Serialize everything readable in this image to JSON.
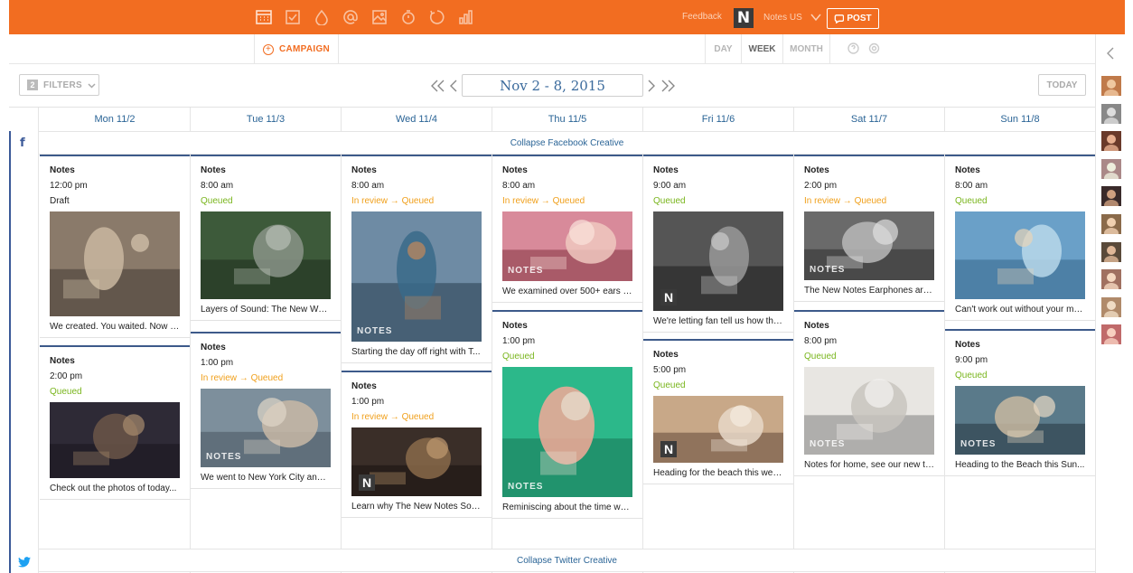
{
  "topbar": {
    "feedback": "Feedback",
    "brand_letter": "N",
    "brand_name": "Notes US",
    "post_label": "POST",
    "tool_icons": [
      "calendar-icon",
      "drafts-icon",
      "drop-icon",
      "mention-icon",
      "image-icon",
      "timer-icon",
      "circle-icon",
      "analytics-icon"
    ],
    "accent": "#f26d21"
  },
  "subbar": {
    "campaign_label": "CAMPAIGN",
    "views": [
      "DAY",
      "WEEK",
      "MONTH"
    ],
    "active_view": "WEEK"
  },
  "nav": {
    "filter_count": "2",
    "filters_label": "FILTERS",
    "date_range": "Nov 2 - 8, 2015",
    "today_label": "TODAY"
  },
  "days": [
    "Mon 11/2",
    "Tue 11/3",
    "Wed 11/4",
    "Thu 11/5",
    "Fri 11/6",
    "Sat 11/7",
    "Sun 11/8"
  ],
  "networks": {
    "facebook_icon": "f",
    "collapse_facebook": "Collapse Facebook Creative",
    "collapse_twitter": "Collapse Twitter Creative"
  },
  "status_arrow": "In review → Queued",
  "posts": [
    {
      "day": 0,
      "account": "Notes",
      "time": "12:00 pm",
      "status": "Draft",
      "status_type": "draft",
      "caption": "We created. You waited. Now t..."
    },
    {
      "day": 0,
      "account": "Notes",
      "time": "2:00 pm",
      "status": "Queued",
      "status_type": "queued",
      "caption": "Check out the photos of today..."
    },
    {
      "day": 1,
      "account": "Notes",
      "time": "8:00 am",
      "status": "Queued",
      "status_type": "queued",
      "caption": "Layers of Sound: The New Wor..."
    },
    {
      "day": 1,
      "account": "Notes",
      "time": "1:00 pm",
      "status": "In review → Queued",
      "status_type": "review",
      "caption": "We went to New York City and ...",
      "watermark": "NOTES"
    },
    {
      "day": 2,
      "account": "Notes",
      "time": "8:00 am",
      "status": "In review → Queued",
      "status_type": "review",
      "caption": "Starting the day off right with T...",
      "watermark": "NOTES"
    },
    {
      "day": 2,
      "account": "Notes",
      "time": "1:00 pm",
      "status": "In review → Queued",
      "status_type": "review",
      "caption": "Learn why The New Notes Sou...",
      "watermark_n": "N"
    },
    {
      "day": 3,
      "account": "Notes",
      "time": "8:00 am",
      "status": "In review → Queued",
      "status_type": "review",
      "caption": "We examined over 500+ ears t...",
      "watermark": "NOTES"
    },
    {
      "day": 3,
      "account": "Notes",
      "time": "1:00 pm",
      "status": "Queued",
      "status_type": "queued",
      "caption": "Reminiscing about the time we ...",
      "watermark": "NOTES"
    },
    {
      "day": 4,
      "account": "Notes",
      "time": "9:00 am",
      "status": "Queued",
      "status_type": "queued",
      "caption": "We're letting fan tell us how the...",
      "watermark_n": "N"
    },
    {
      "day": 4,
      "account": "Notes",
      "time": "5:00 pm",
      "status": "Queued",
      "status_type": "queued",
      "caption": "Heading for the beach this wee...",
      "watermark_n": "N"
    },
    {
      "day": 5,
      "account": "Notes",
      "time": "2:00 pm",
      "status": "In review → Queued",
      "status_type": "review",
      "caption": "The New Notes Earphones are ...",
      "watermark": "NOTES"
    },
    {
      "day": 5,
      "account": "Notes",
      "time": "8:00 pm",
      "status": "Queued",
      "status_type": "queued",
      "caption": "Notes for home, see our new ti...",
      "watermark": "NOTES"
    },
    {
      "day": 6,
      "account": "Notes",
      "time": "8:00 am",
      "status": "Queued",
      "status_type": "queued",
      "caption": "Can't work out without your mu..."
    },
    {
      "day": 6,
      "account": "Notes",
      "time": "9:00 pm",
      "status": "Queued",
      "status_type": "queued",
      "caption": "Heading to the Beach this Sun...",
      "watermark": "NOTES"
    }
  ]
}
